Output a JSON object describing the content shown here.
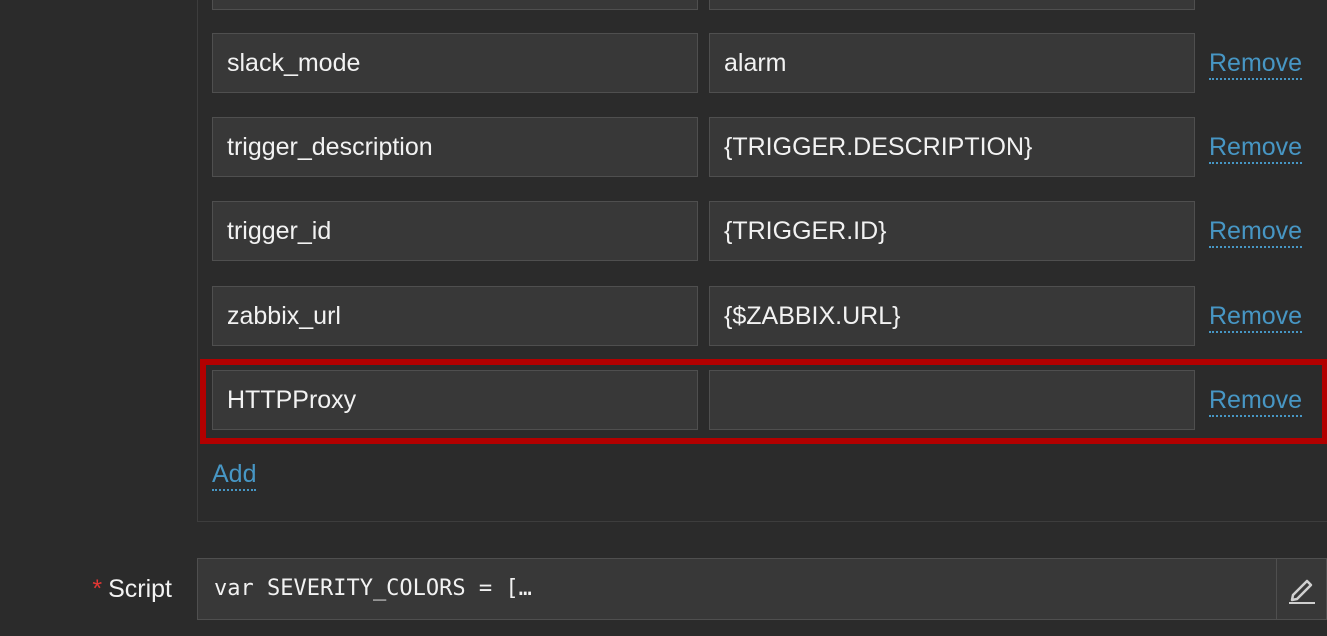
{
  "parameters": {
    "rows": [
      {
        "name": "",
        "value": "",
        "remove_label": ""
      },
      {
        "name": "slack_mode",
        "value": "alarm",
        "remove_label": "Remove"
      },
      {
        "name": "trigger_description",
        "value": "{TRIGGER.DESCRIPTION}",
        "remove_label": "Remove"
      },
      {
        "name": "trigger_id",
        "value": "{TRIGGER.ID}",
        "remove_label": "Remove"
      },
      {
        "name": "zabbix_url",
        "value": "{$ZABBIX.URL}",
        "remove_label": "Remove"
      },
      {
        "name": "HTTPProxy",
        "value": "",
        "remove_label": "Remove"
      }
    ],
    "add_label": "Add"
  },
  "script": {
    "required_marker": "*",
    "label": "Script",
    "value": "var SEVERITY_COLORS = […",
    "edit_icon": "pencil-icon"
  },
  "colors": {
    "background": "#2b2b2b",
    "field_background": "#383838",
    "link": "#4796c4",
    "highlight_border": "#b20000",
    "required": "#e33734"
  }
}
